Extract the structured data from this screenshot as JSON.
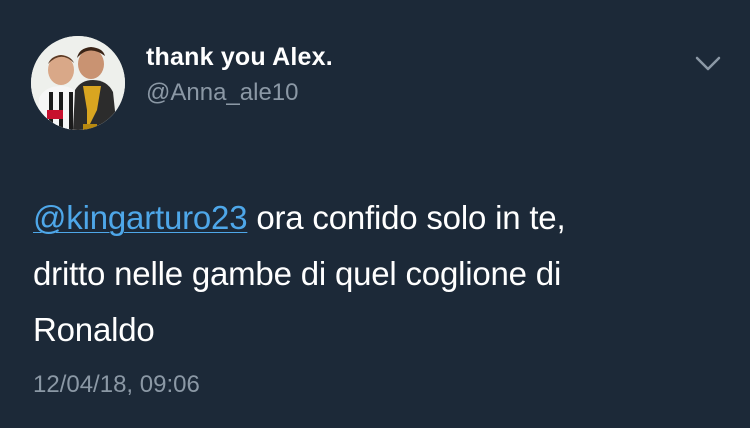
{
  "tweet": {
    "author": {
      "display_name": "thank you Alex.",
      "handle": "@Anna_ale10"
    },
    "menu_icon": "chevron-down-icon",
    "text": {
      "mention": "@kingarturo23",
      "line1_rest": " ora confido solo in te,",
      "line2": "dritto nelle gambe di quel coglione di",
      "line3": "Ronaldo"
    },
    "timestamp": "12/04/18, 09:06"
  },
  "colors": {
    "background": "#1c2938",
    "primary_text": "#ffffff",
    "secondary_text": "#8b98a5",
    "link": "#4ea7e9"
  }
}
